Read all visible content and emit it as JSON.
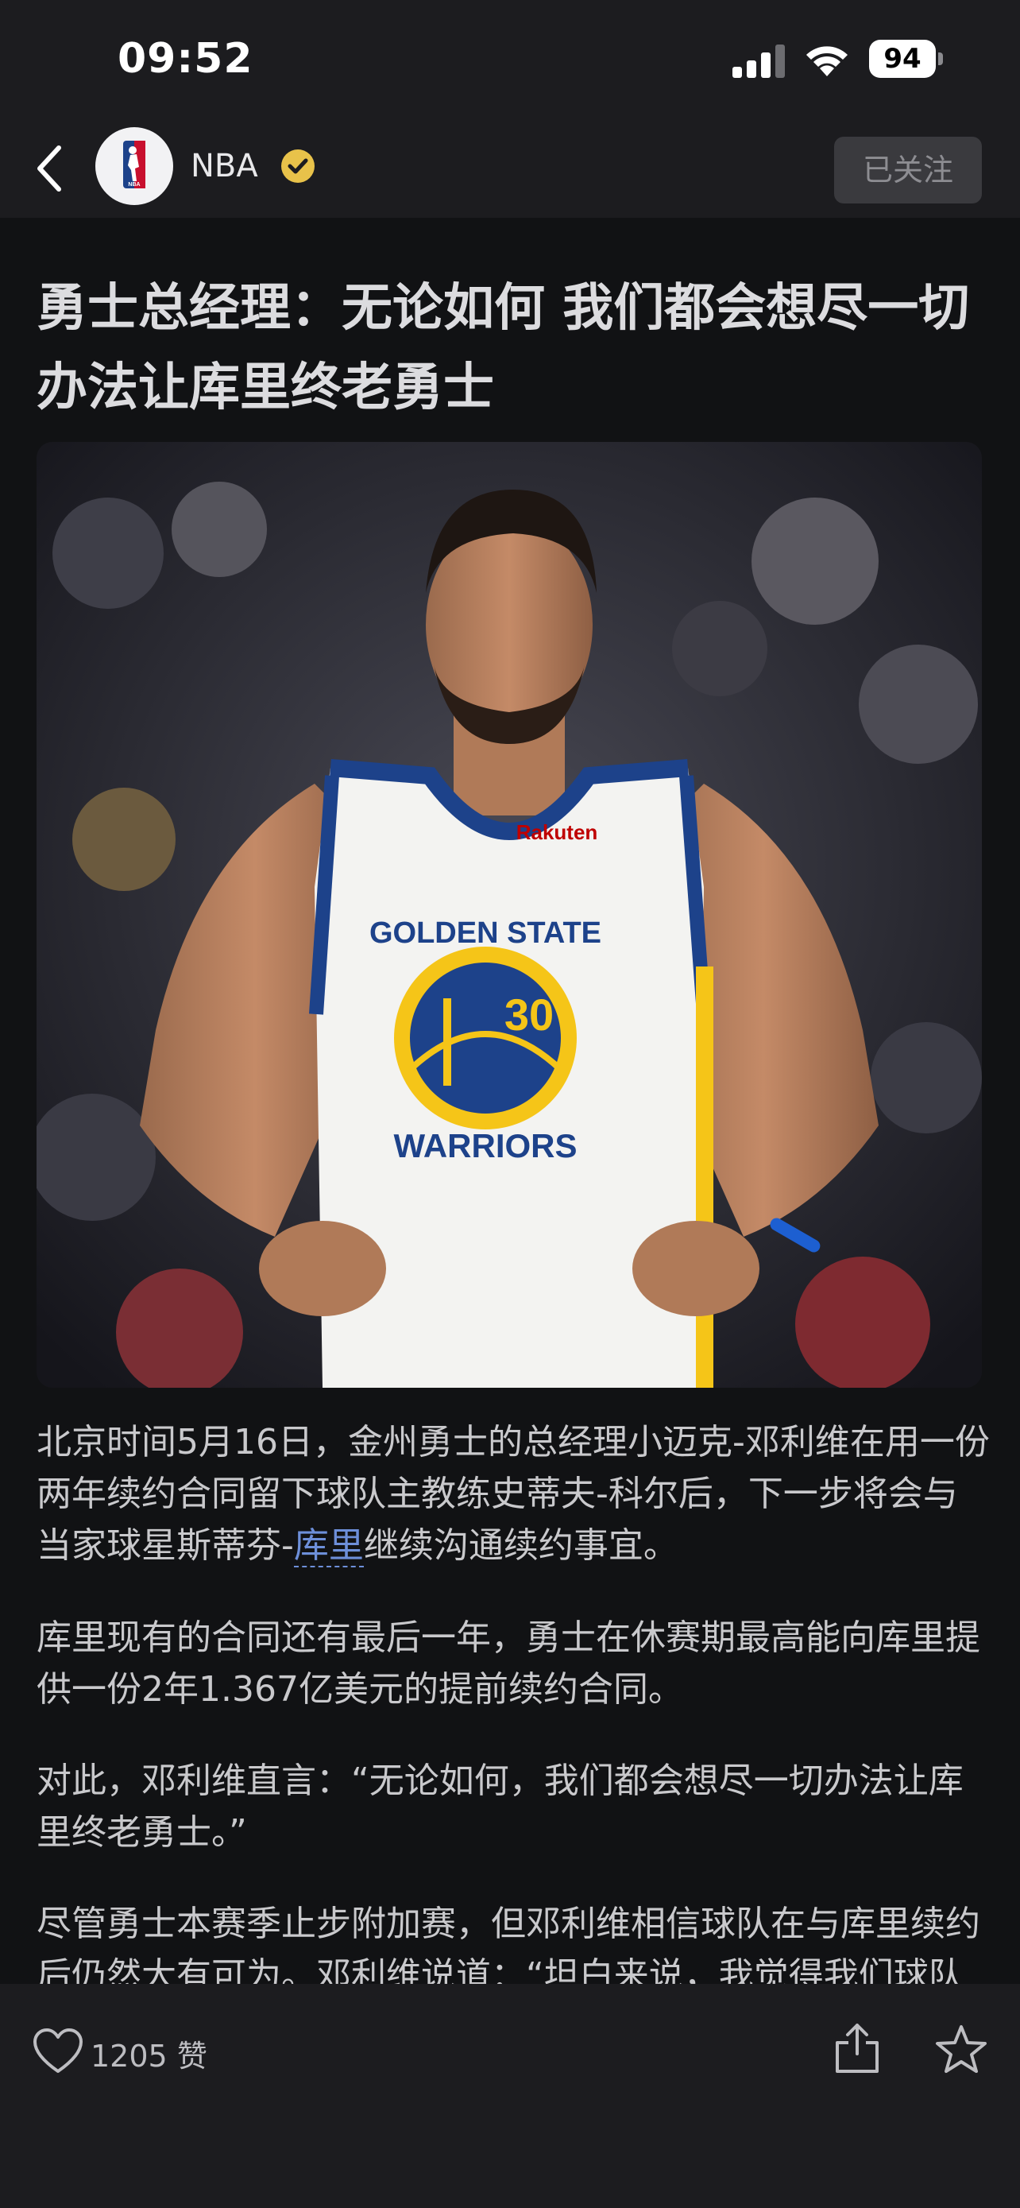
{
  "status_bar": {
    "time": "09:52",
    "battery": "94"
  },
  "header": {
    "channel_name": "NBA",
    "follow_label": "已关注"
  },
  "article": {
    "title": "勇士总经理：无论如何 我们都会想尽一切办法让库里终老勇士",
    "photo_alt": "",
    "paragraphs": [
      {
        "before": "北京时间5月16日，金州勇士的总经理小迈克-邓利维在用一份两年续约合同留下球队主教练史蒂夫-科尔后，下一步将会与当家球星斯蒂芬-",
        "link": "库里",
        "after": "继续沟通续约事宜。"
      },
      {
        "text": "库里现有的合同还有最后一年，勇士在休赛期最高能向库里提供一份2年1.367亿美元的提前续约合同。"
      },
      {
        "text": "对此，邓利维直言：“无论如何，我们都会想尽一切办法让库里终老勇士。”"
      },
      {
        "text": "尽管勇士本赛季止步附加赛，但邓利维相信球队在与库里续约后仍然大有可为。邓利维说道：“坦白来说，我觉得我们球队本赛季失利的原因不在于防守那里，而是在"
      }
    ]
  },
  "bottom_bar": {
    "like_count": "1205",
    "like_unit": "赞"
  },
  "colors": {
    "background": "#111214",
    "bar": "#1c1c1f",
    "verified": "#e8c24a",
    "link": "#6d8fd9"
  }
}
